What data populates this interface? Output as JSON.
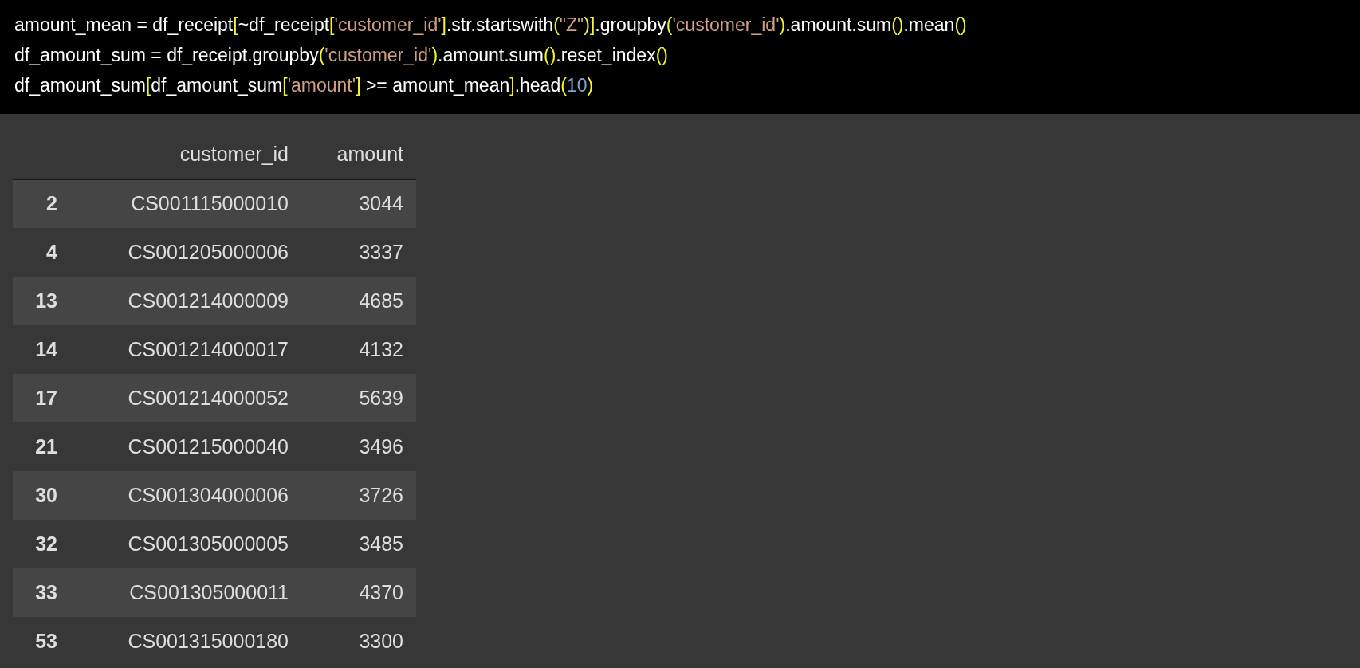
{
  "code_lines": [
    [
      {
        "kind": "plain",
        "text": "amount_mean = df_receipt"
      },
      {
        "kind": "bracket",
        "text": "["
      },
      {
        "kind": "plain",
        "text": "~df_receipt"
      },
      {
        "kind": "bracket",
        "text": "["
      },
      {
        "kind": "string",
        "text": "'customer_id'"
      },
      {
        "kind": "bracket",
        "text": "]"
      },
      {
        "kind": "plain",
        "text": ".str.startswith"
      },
      {
        "kind": "bracket",
        "text": "("
      },
      {
        "kind": "string",
        "text": "\"Z\""
      },
      {
        "kind": "bracket",
        "text": ")]"
      },
      {
        "kind": "plain",
        "text": ".groupby"
      },
      {
        "kind": "bracket",
        "text": "("
      },
      {
        "kind": "string",
        "text": "'customer_id'"
      },
      {
        "kind": "bracket",
        "text": ")"
      },
      {
        "kind": "plain",
        "text": ".amount.sum"
      },
      {
        "kind": "bracket",
        "text": "()"
      },
      {
        "kind": "plain",
        "text": ".mean"
      },
      {
        "kind": "bracket",
        "text": "()"
      }
    ],
    [
      {
        "kind": "plain",
        "text": "df_amount_sum = df_receipt.groupby"
      },
      {
        "kind": "bracket",
        "text": "("
      },
      {
        "kind": "string",
        "text": "'customer_id'"
      },
      {
        "kind": "bracket",
        "text": ")"
      },
      {
        "kind": "plain",
        "text": ".amount.sum"
      },
      {
        "kind": "bracket",
        "text": "()"
      },
      {
        "kind": "plain",
        "text": ".reset_index"
      },
      {
        "kind": "bracket",
        "text": "()"
      }
    ],
    [
      {
        "kind": "plain",
        "text": "df_amount_sum"
      },
      {
        "kind": "bracket",
        "text": "["
      },
      {
        "kind": "plain",
        "text": "df_amount_sum"
      },
      {
        "kind": "bracket",
        "text": "["
      },
      {
        "kind": "string",
        "text": "'amount'"
      },
      {
        "kind": "bracket",
        "text": "]"
      },
      {
        "kind": "plain",
        "text": " >= amount_mean"
      },
      {
        "kind": "bracket",
        "text": "]"
      },
      {
        "kind": "plain",
        "text": ".head"
      },
      {
        "kind": "bracket",
        "text": "("
      },
      {
        "kind": "number",
        "text": "10"
      },
      {
        "kind": "bracket",
        "text": ")"
      }
    ]
  ],
  "table": {
    "columns": [
      "customer_id",
      "amount"
    ],
    "rows": [
      {
        "index": "2",
        "customer_id": "CS001115000010",
        "amount": "3044"
      },
      {
        "index": "4",
        "customer_id": "CS001205000006",
        "amount": "3337"
      },
      {
        "index": "13",
        "customer_id": "CS001214000009",
        "amount": "4685"
      },
      {
        "index": "14",
        "customer_id": "CS001214000017",
        "amount": "4132"
      },
      {
        "index": "17",
        "customer_id": "CS001214000052",
        "amount": "5639"
      },
      {
        "index": "21",
        "customer_id": "CS001215000040",
        "amount": "3496"
      },
      {
        "index": "30",
        "customer_id": "CS001304000006",
        "amount": "3726"
      },
      {
        "index": "32",
        "customer_id": "CS001305000005",
        "amount": "3485"
      },
      {
        "index": "33",
        "customer_id": "CS001305000011",
        "amount": "4370"
      },
      {
        "index": "53",
        "customer_id": "CS001315000180",
        "amount": "3300"
      }
    ]
  }
}
